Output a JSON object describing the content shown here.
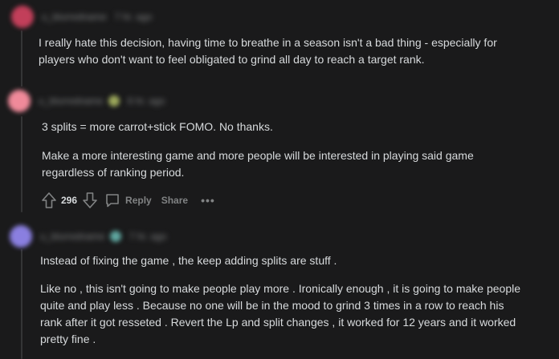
{
  "comments": [
    {
      "username": "u_blurredname",
      "time": "7 hr. ago",
      "avatar_color": "#c23f5a",
      "paragraphs": [
        "I really hate this decision, having time to breathe in a season isn't a bad thing - especially for",
        "players who don't want to feel obligated to grind all day to reach a target rank."
      ]
    },
    {
      "username": "u_blurredname",
      "time": "6 hr. ago",
      "avatar_color": "#f08a9a",
      "badge_color": "#9ba65a",
      "paragraphs": [
        "3 splits = more carrot+stick FOMO. No thanks.",
        "Make a more interesting game and more people will be interested in playing said game",
        "regardless of ranking period."
      ],
      "actions": {
        "upvote_icon": "upvote-arrow-icon",
        "score": "296",
        "downvote_icon": "downvote-arrow-icon",
        "reply_icon": "speech-bubble-icon",
        "reply_label": "Reply",
        "share_label": "Share",
        "more_label": "•••"
      }
    },
    {
      "username": "u_blurredname",
      "time": "7 hr. ago",
      "avatar_color": "#8a7fe0",
      "badge_color": "#5fa7a0",
      "paragraphs": [
        "Instead of fixing the game , the keep adding splits are stuff .",
        "Like no , this isn't going to make people play more . Ironically enough , it is going to make people",
        "quite and play less . Because no one will be in the mood to grind 3 times in a row to reach his",
        "rank after it got resseted . Revert the Lp and split changes , it worked for 12 years and it worked",
        "pretty fine ."
      ]
    }
  ]
}
